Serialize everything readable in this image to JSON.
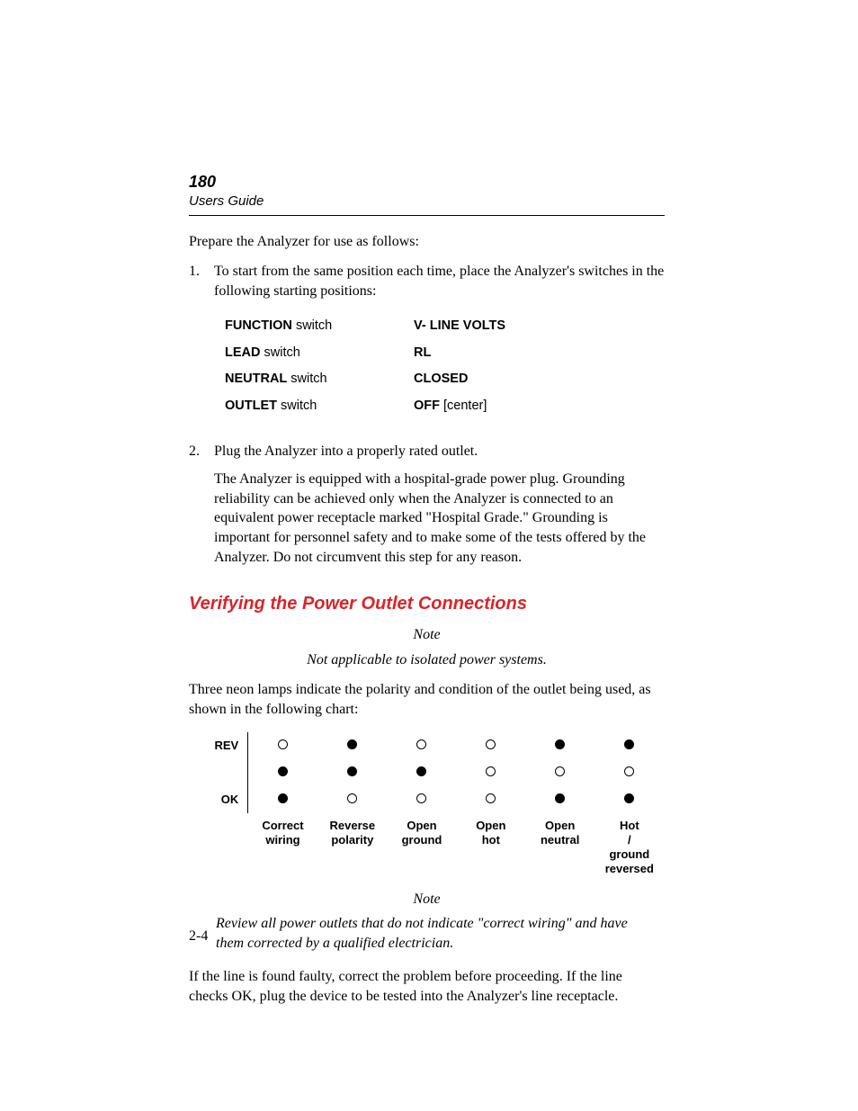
{
  "header": {
    "number": "180",
    "sub": "Users Guide"
  },
  "intro": "Prepare the Analyzer for use as follows:",
  "steps": [
    {
      "num": "1.",
      "text": "To start from the same position each time, place the Analyzer's switches in the following starting positions:"
    },
    {
      "num": "2.",
      "text": "Plug the Analyzer into a properly rated outlet.",
      "sub": "The Analyzer is equipped with a hospital-grade power plug. Grounding reliability can be achieved only when the Analyzer is connected to an equivalent power receptacle marked \"Hospital Grade.\" Grounding is important for personnel safety and to make some of the tests offered by the Analyzer. Do not circumvent this step for any reason."
    }
  ],
  "switch_table": [
    {
      "label_bold": "FUNCTION",
      "label_rest": " switch",
      "value_bold": "V- LINE VOLTS",
      "value_rest": ""
    },
    {
      "label_bold": "LEAD",
      "label_rest": " switch",
      "value_bold": "RL",
      "value_rest": ""
    },
    {
      "label_bold": "NEUTRAL",
      "label_rest": " switch",
      "value_bold": "CLOSED",
      "value_rest": ""
    },
    {
      "label_bold": "OUTLET",
      "label_rest": " switch",
      "value_bold": "OFF",
      "value_rest": " [center]"
    }
  ],
  "section_heading": "Verifying the Power Outlet Connections",
  "note1": {
    "label": "Note",
    "body": "Not applicable to isolated power systems."
  },
  "chart_intro": "Three neon lamps indicate the polarity and condition of the outlet being used, as shown in the following chart:",
  "chart_data": {
    "type": "table",
    "row_labels": [
      "REV",
      "",
      "OK"
    ],
    "columns": [
      "Correct wiring",
      "Reverse polarity",
      "Open ground",
      "Open hot",
      "Open neutral",
      "Hot / ground reversed"
    ],
    "cells": [
      [
        "off",
        "on",
        "off",
        "off",
        "on",
        "on"
      ],
      [
        "on",
        "on",
        "on",
        "off",
        "off",
        "off"
      ],
      [
        "on",
        "off",
        "off",
        "off",
        "on",
        "on"
      ]
    ]
  },
  "note2": {
    "label": "Note",
    "body": "Review all power outlets that do not indicate \"correct wiring\" and have them corrected by a qualified electrician."
  },
  "closing": "If the line is found faulty, correct the problem before proceeding. If the line checks OK, plug the device to be tested into the Analyzer's line receptacle.",
  "page_number": "2-4"
}
